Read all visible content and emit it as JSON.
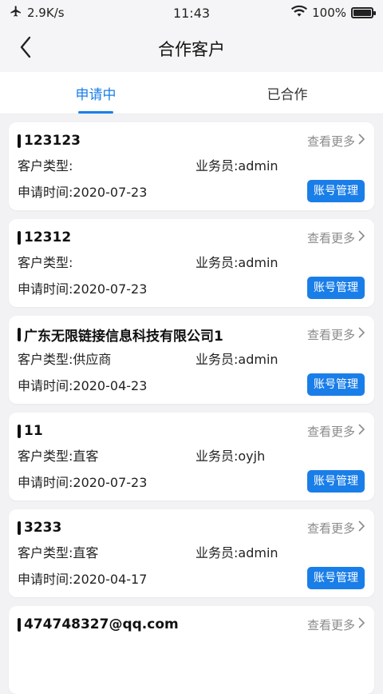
{
  "status_bar": {
    "network_speed": "2.9K/s",
    "time": "11:43",
    "battery_text": "100%"
  },
  "header": {
    "title": "合作客户"
  },
  "tabs": [
    {
      "label": "申请中",
      "active": true
    },
    {
      "label": "已合作",
      "active": false
    }
  ],
  "labels": {
    "more": "查看更多",
    "manage": "账号管理"
  },
  "customers": [
    {
      "name": "123123",
      "type": "客户类型:",
      "salesman": "业务员:admin",
      "apply_time": "申请时间:2020-07-23"
    },
    {
      "name": "12312",
      "type": "客户类型:",
      "salesman": "业务员:admin",
      "apply_time": "申请时间:2020-07-23"
    },
    {
      "name": "广东无限链接信息科技有限公司1",
      "type": "客户类型:供应商",
      "salesman": "业务员:admin",
      "apply_time": "申请时间:2020-04-23"
    },
    {
      "name": "11",
      "type": "客户类型:直客",
      "salesman": "业务员:oyjh",
      "apply_time": "申请时间:2020-07-23"
    },
    {
      "name": "3233",
      "type": "客户类型:直客",
      "salesman": "业务员:admin",
      "apply_time": "申请时间:2020-04-17"
    },
    {
      "name": "474748327@qq.com",
      "type": "",
      "salesman": "",
      "apply_time": ""
    }
  ],
  "colors": {
    "accent": "#1a7ee8",
    "background": "#f2f2f4"
  }
}
